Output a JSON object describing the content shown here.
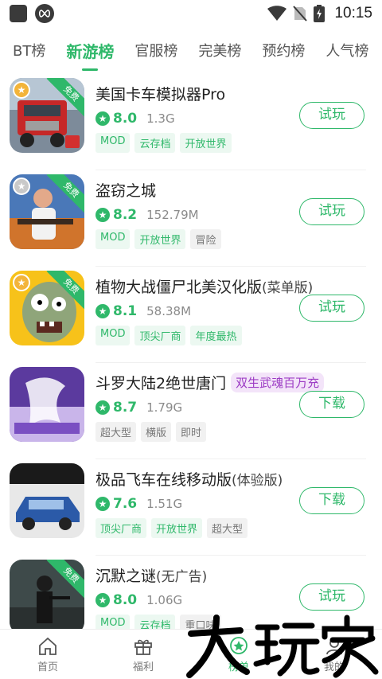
{
  "status_bar": {
    "time": "10:15"
  },
  "tabs": [
    {
      "label": "BT榜",
      "active": false
    },
    {
      "label": "新游榜",
      "active": true
    },
    {
      "label": "官服榜",
      "active": false
    },
    {
      "label": "完美榜",
      "active": false
    },
    {
      "label": "预约榜",
      "active": false
    },
    {
      "label": "人气榜",
      "active": false
    }
  ],
  "ribbon_label": "免费",
  "games": [
    {
      "name": "美国卡车模拟器Pro",
      "suffix": "",
      "promo": "",
      "score": "8.0",
      "size": "1.3G",
      "tags": [
        {
          "text": "MOD",
          "style": "g"
        },
        {
          "text": "云存档",
          "style": "g"
        },
        {
          "text": "开放世界",
          "style": "g"
        }
      ],
      "button": "试玩",
      "icon": "truck-game-icon"
    },
    {
      "name": "盗窃之城",
      "suffix": "",
      "promo": "",
      "score": "8.2",
      "size": "152.79M",
      "tags": [
        {
          "text": "MOD",
          "style": "g"
        },
        {
          "text": "开放世界",
          "style": "g"
        },
        {
          "text": "冒险",
          "style": "gr"
        }
      ],
      "button": "试玩",
      "icon": "gangster-game-icon"
    },
    {
      "name": "植物大战僵尸北美汉化版",
      "suffix": "(菜单版)",
      "promo": "",
      "score": "8.1",
      "size": "58.38M",
      "tags": [
        {
          "text": "MOD",
          "style": "g"
        },
        {
          "text": "顶尖厂商",
          "style": "g"
        },
        {
          "text": "年度最热",
          "style": "g"
        }
      ],
      "button": "试玩",
      "icon": "zombie-game-icon"
    },
    {
      "name": "斗罗大陆2绝世唐门",
      "suffix": "",
      "promo": "双生武魂百万充",
      "score": "8.7",
      "size": "1.79G",
      "tags": [
        {
          "text": "超大型",
          "style": "gr"
        },
        {
          "text": "横版",
          "style": "gr"
        },
        {
          "text": "即时",
          "style": "gr"
        }
      ],
      "button": "下载",
      "icon": "douluo-game-icon"
    },
    {
      "name": "极品飞车在线移动版",
      "suffix": "(体验版)",
      "promo": "",
      "score": "7.6",
      "size": "1.51G",
      "tags": [
        {
          "text": "顶尖厂商",
          "style": "g"
        },
        {
          "text": "开放世界",
          "style": "g"
        },
        {
          "text": "超大型",
          "style": "gr"
        }
      ],
      "button": "下载",
      "icon": "racing-game-icon"
    },
    {
      "name": "沉默之谜",
      "suffix": "(无广告)",
      "promo": "",
      "score": "8.0",
      "size": "1.06G",
      "tags": [
        {
          "text": "MOD",
          "style": "g"
        },
        {
          "text": "云存档",
          "style": "g"
        },
        {
          "text": "重口味",
          "style": "gr"
        }
      ],
      "button": "试玩",
      "icon": "soldier-game-icon"
    }
  ],
  "bottom_nav": [
    {
      "label": "首页",
      "icon": "home-icon",
      "active": false
    },
    {
      "label": "福利",
      "icon": "gift-icon",
      "active": false
    },
    {
      "label": "榜单",
      "icon": "ranking-icon",
      "active": true
    },
    {
      "label": "我的",
      "icon": "profile-icon",
      "active": false
    }
  ],
  "watermark": "大玩家",
  "colors": {
    "accent": "#2fb86a",
    "promo_bg": "#f3e4f9",
    "promo_text": "#9c3bc4"
  }
}
